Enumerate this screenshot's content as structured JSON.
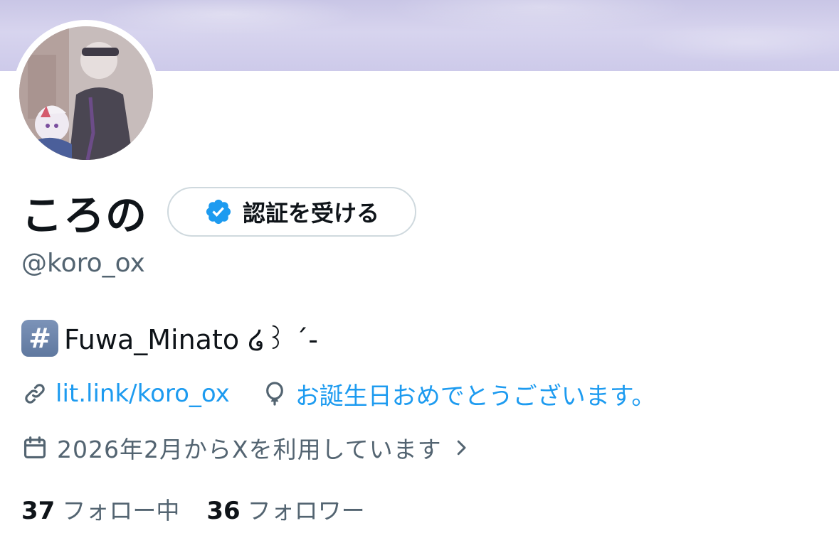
{
  "profile": {
    "display_name": "ころの",
    "handle": "@koro_ox",
    "verify_button_label": "認証を受ける",
    "bio": {
      "hashtag_emoji": "#",
      "text": "Fuwa_Minato ໒꒱ ˊ-"
    },
    "link": "lit.link/koro_ox",
    "birthday": "お誕生日おめでとうございます。",
    "joined": "2026年2月からXを利用しています",
    "following_count": "37",
    "following_label": "フォロー中",
    "followers_count": "36",
    "followers_label": "フォロワー"
  },
  "icons": {
    "verify": "verified-badge-icon",
    "link": "link-icon",
    "birthday": "balloon-icon",
    "joined": "calendar-icon",
    "chevron": "chevron-right-icon"
  },
  "colors": {
    "accent": "#1d9bf0",
    "text_primary": "#0f1419",
    "text_secondary": "#536471",
    "banner": "#cdcaea"
  }
}
